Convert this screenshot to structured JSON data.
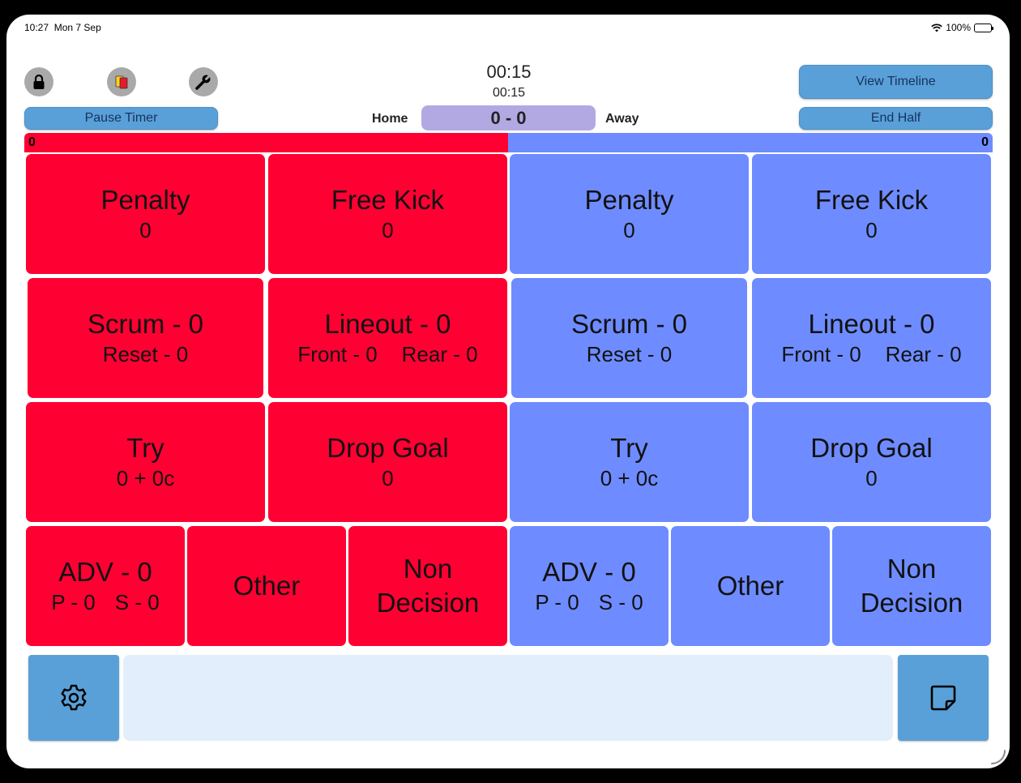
{
  "status_bar": {
    "time": "10:27",
    "date": "Mon 7 Sep",
    "battery": "100%"
  },
  "header": {
    "timer_main": "00:15",
    "timer_sub": "00:15",
    "pause_label": "Pause Timer",
    "view_timeline_label": "View Timeline",
    "end_half_label": "End Half",
    "home_label": "Home",
    "away_label": "Away",
    "score": "0 - 0"
  },
  "bars": {
    "home_value": "0",
    "away_value": "0"
  },
  "home": {
    "penalty": {
      "title": "Penalty",
      "value": "0"
    },
    "free_kick": {
      "title": "Free Kick",
      "value": "0"
    },
    "scrum": {
      "title": "Scrum - 0",
      "reset": "Reset - 0"
    },
    "lineout": {
      "title": "Lineout - 0",
      "front": "Front - 0",
      "rear": "Rear - 0"
    },
    "try": {
      "title": "Try",
      "value": "0 + 0c"
    },
    "drop_goal": {
      "title": "Drop Goal",
      "value": "0"
    },
    "adv": {
      "title": "ADV - 0",
      "p": "P - 0",
      "s": "S - 0"
    },
    "other": {
      "title": "Other"
    },
    "non_decision": {
      "line1": "Non",
      "line2": "Decision"
    }
  },
  "away": {
    "penalty": {
      "title": "Penalty",
      "value": "0"
    },
    "free_kick": {
      "title": "Free Kick",
      "value": "0"
    },
    "scrum": {
      "title": "Scrum - 0",
      "reset": "Reset - 0"
    },
    "lineout": {
      "title": "Lineout - 0",
      "front": "Front - 0",
      "rear": "Rear - 0"
    },
    "try": {
      "title": "Try",
      "value": "0 + 0c"
    },
    "drop_goal": {
      "title": "Drop Goal",
      "value": "0"
    },
    "adv": {
      "title": "ADV - 0",
      "p": "P - 0",
      "s": "S - 0"
    },
    "other": {
      "title": "Other"
    },
    "non_decision": {
      "line1": "Non",
      "line2": "Decision"
    }
  },
  "icons": {
    "lock": "lock-icon",
    "cards": "cards-icon",
    "wrench": "wrench-icon",
    "settings": "gear-icon",
    "notes": "note-icon"
  },
  "colors": {
    "home": "#ff0033",
    "away": "#6e8cff",
    "button": "#5aa0d8",
    "score_box": "#b3a9e2",
    "notes": "#e2eefb"
  }
}
